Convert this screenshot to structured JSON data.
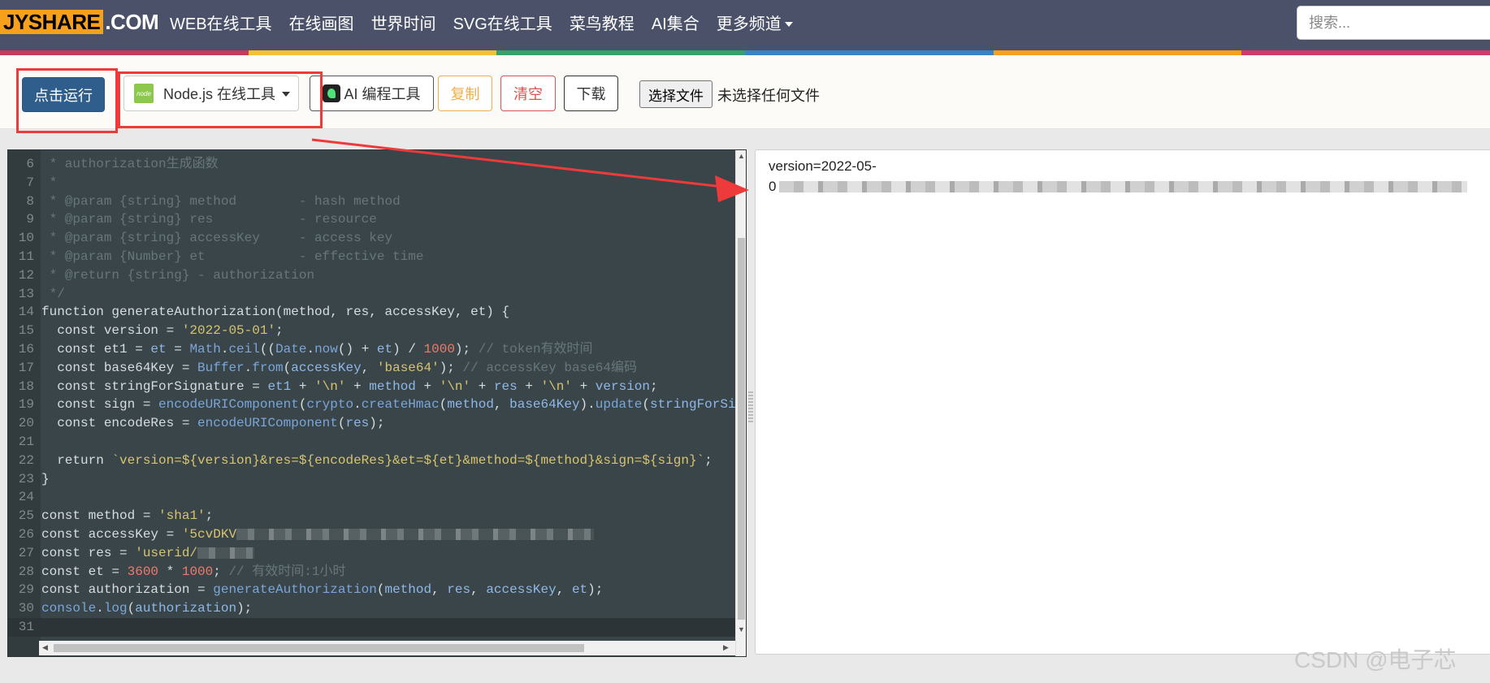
{
  "nav": {
    "logo_mark": "JYSHARE",
    "logo_com": ".COM",
    "links": [
      "WEB在线工具",
      "在线画图",
      "世界时间",
      "SVG在线工具",
      "菜鸟教程",
      "AI集合",
      "更多频道"
    ],
    "search_placeholder": "搜索..."
  },
  "toolbar": {
    "run": "点击运行",
    "lang_icon": "node",
    "lang": "Node.js 在线工具",
    "ai": "AI 编程工具",
    "copy": "复制",
    "clear": "清空",
    "download": "下载",
    "choose_file": "选择文件",
    "no_file": "未选择任何文件"
  },
  "editor": {
    "lines": [
      {
        "n": "6",
        "segs": [
          [
            "c-comment",
            " * authorization生成函数"
          ]
        ]
      },
      {
        "n": "7",
        "segs": [
          [
            "c-comment",
            " *"
          ]
        ]
      },
      {
        "n": "8",
        "segs": [
          [
            "c-comment",
            " * @param {string} method        - hash method"
          ]
        ]
      },
      {
        "n": "9",
        "segs": [
          [
            "c-comment",
            " * @param {string} res           - resource"
          ]
        ]
      },
      {
        "n": "10",
        "segs": [
          [
            "c-comment",
            " * @param {string} accessKey     - access key"
          ]
        ]
      },
      {
        "n": "11",
        "segs": [
          [
            "c-comment",
            " * @param {Number} et            - effective time"
          ]
        ]
      },
      {
        "n": "12",
        "segs": [
          [
            "c-comment",
            " * @return {string} - authorization"
          ]
        ]
      },
      {
        "n": "13",
        "segs": [
          [
            "c-comment",
            " */"
          ]
        ]
      },
      {
        "n": "14",
        "segs": [
          [
            "c-kw",
            "function generateAuthorization(method, res, accessKey, et) {"
          ]
        ]
      },
      {
        "n": "15",
        "segs": [
          [
            "c-kw",
            "  const version = "
          ],
          [
            "c-str",
            "'2022-05-01'"
          ],
          [
            "c-kw",
            ";"
          ]
        ]
      },
      {
        "n": "16",
        "segs": [
          [
            "c-kw",
            "  const et1 = "
          ],
          [
            "c-var",
            "et"
          ],
          [
            "c-kw",
            " = "
          ],
          [
            "c-fn",
            "Math"
          ],
          [
            "c-kw",
            "."
          ],
          [
            "c-fn",
            "ceil"
          ],
          [
            "c-kw",
            "(("
          ],
          [
            "c-fn",
            "Date"
          ],
          [
            "c-kw",
            "."
          ],
          [
            "c-fn",
            "now"
          ],
          [
            "c-kw",
            "() + "
          ],
          [
            "c-var",
            "et"
          ],
          [
            "c-kw",
            ") / "
          ],
          [
            "c-num",
            "1000"
          ],
          [
            "c-kw",
            "); "
          ],
          [
            "c-comment",
            "// token有效时间"
          ]
        ]
      },
      {
        "n": "17",
        "segs": [
          [
            "c-kw",
            "  const base64Key = "
          ],
          [
            "c-fn",
            "Buffer"
          ],
          [
            "c-kw",
            "."
          ],
          [
            "c-fn",
            "from"
          ],
          [
            "c-kw",
            "("
          ],
          [
            "c-var",
            "accessKey"
          ],
          [
            "c-kw",
            ", "
          ],
          [
            "c-str",
            "'base64'"
          ],
          [
            "c-kw",
            "); "
          ],
          [
            "c-comment",
            "// accessKey base64编码"
          ]
        ]
      },
      {
        "n": "18",
        "segs": [
          [
            "c-kw",
            "  const stringForSignature = "
          ],
          [
            "c-var",
            "et1"
          ],
          [
            "c-kw",
            " + "
          ],
          [
            "c-str",
            "'\\n'"
          ],
          [
            "c-kw",
            " + "
          ],
          [
            "c-var",
            "method"
          ],
          [
            "c-kw",
            " + "
          ],
          [
            "c-str",
            "'\\n'"
          ],
          [
            "c-kw",
            " + "
          ],
          [
            "c-var",
            "res"
          ],
          [
            "c-kw",
            " + "
          ],
          [
            "c-str",
            "'\\n'"
          ],
          [
            "c-kw",
            " + "
          ],
          [
            "c-var",
            "version"
          ],
          [
            "c-kw",
            ";"
          ]
        ]
      },
      {
        "n": "19",
        "segs": [
          [
            "c-kw",
            "  const sign = "
          ],
          [
            "c-fn",
            "encodeURIComponent"
          ],
          [
            "c-kw",
            "("
          ],
          [
            "c-fn",
            "crypto"
          ],
          [
            "c-kw",
            "."
          ],
          [
            "c-fn",
            "createHmac"
          ],
          [
            "c-kw",
            "("
          ],
          [
            "c-var",
            "method"
          ],
          [
            "c-kw",
            ", "
          ],
          [
            "c-var",
            "base64Key"
          ],
          [
            "c-kw",
            ")."
          ],
          [
            "c-fn",
            "update"
          ],
          [
            "c-kw",
            "("
          ],
          [
            "c-var",
            "stringForSignatu"
          ]
        ]
      },
      {
        "n": "20",
        "segs": [
          [
            "c-kw",
            "  const encodeRes = "
          ],
          [
            "c-fn",
            "encodeURIComponent"
          ],
          [
            "c-kw",
            "("
          ],
          [
            "c-var",
            "res"
          ],
          [
            "c-kw",
            ");"
          ]
        ]
      },
      {
        "n": "21",
        "segs": []
      },
      {
        "n": "22",
        "segs": [
          [
            "c-kw",
            "  return "
          ],
          [
            "c-str",
            "`version=${version}&res=${encodeRes}&et=${et}&method=${method}&sign=${sign}`"
          ],
          [
            "c-kw",
            ";"
          ]
        ]
      },
      {
        "n": "23",
        "segs": [
          [
            "c-kw",
            "}"
          ]
        ]
      },
      {
        "n": "24",
        "segs": []
      },
      {
        "n": "25",
        "segs": [
          [
            "c-kw",
            "const method = "
          ],
          [
            "c-str",
            "'sha1'"
          ],
          [
            "c-kw",
            ";"
          ]
        ]
      },
      {
        "n": "26",
        "segs": [
          [
            "c-kw",
            "const accessKey = "
          ],
          [
            "c-str",
            "'5cvDKV"
          ],
          [
            "blur",
            "440"
          ]
        ]
      },
      {
        "n": "27",
        "segs": [
          [
            "c-kw",
            "const res = "
          ],
          [
            "c-str",
            "'userid/"
          ],
          [
            "blur",
            "70"
          ]
        ]
      },
      {
        "n": "28",
        "segs": [
          [
            "c-kw",
            "const et = "
          ],
          [
            "c-num",
            "3600"
          ],
          [
            "c-kw",
            " * "
          ],
          [
            "c-num",
            "1000"
          ],
          [
            "c-kw",
            "; "
          ],
          [
            "c-comment",
            "// 有效时间:1小时"
          ]
        ]
      },
      {
        "n": "29",
        "segs": [
          [
            "c-kw",
            "const authorization = "
          ],
          [
            "c-fn",
            "generateAuthorization"
          ],
          [
            "c-kw",
            "("
          ],
          [
            "c-var",
            "method"
          ],
          [
            "c-kw",
            ", "
          ],
          [
            "c-var",
            "res"
          ],
          [
            "c-kw",
            ", "
          ],
          [
            "c-var",
            "accessKey"
          ],
          [
            "c-kw",
            ", "
          ],
          [
            "c-var",
            "et"
          ],
          [
            "c-kw",
            ");"
          ]
        ]
      },
      {
        "n": "30",
        "segs": [
          [
            "c-fn",
            "console"
          ],
          [
            "c-kw",
            "."
          ],
          [
            "c-fn",
            "log"
          ],
          [
            "c-kw",
            "("
          ],
          [
            "c-var",
            "authorization"
          ],
          [
            "c-kw",
            ");"
          ]
        ]
      },
      {
        "n": "31",
        "segs": []
      }
    ]
  },
  "output": {
    "line1": "version=2022-05-",
    "line2_start": "0"
  },
  "watermark": "CSDN @电子芯"
}
